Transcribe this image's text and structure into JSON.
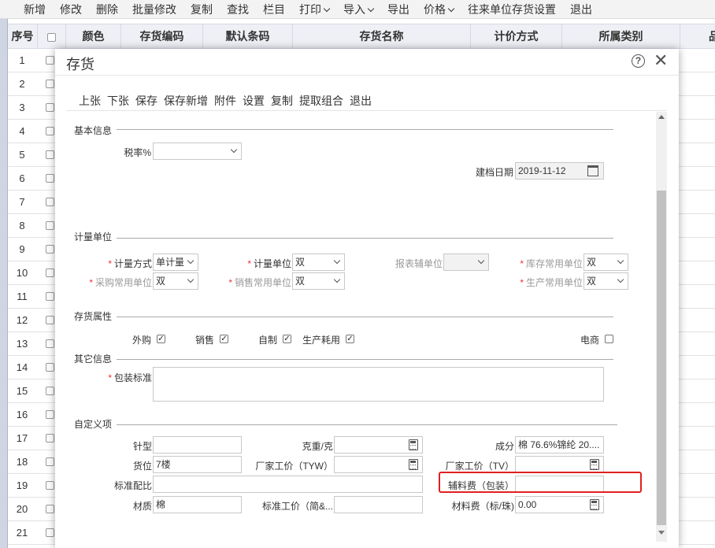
{
  "toolbar": {
    "items": [
      "新增",
      "修改",
      "删除",
      "批量修改",
      "复制",
      "查找",
      "栏目",
      "打印",
      "导入",
      "导出",
      "价格",
      "往来单位存货设置",
      "退出"
    ]
  },
  "grid": {
    "headers": [
      "序号",
      "颜色",
      "存货编码",
      "默认条码",
      "存货名称",
      "计价方式",
      "所属类别",
      "品"
    ],
    "rows": [
      "1",
      "2",
      "3",
      "4",
      "5",
      "6",
      "7",
      "8",
      "9",
      "10",
      "11",
      "12",
      "13",
      "14",
      "15",
      "16",
      "17",
      "18",
      "19",
      "20",
      "21"
    ]
  },
  "dialog": {
    "title": "存货",
    "toolbar": [
      "上张",
      "下张",
      "保存",
      "保存新增",
      "附件",
      "设置",
      "复制",
      "提取组合",
      "退出"
    ],
    "basic": {
      "section": "基本信息",
      "tax_label": "税率%",
      "tax_value": "",
      "date_label": "建档日期",
      "date_value": "2019-11-12"
    },
    "units": {
      "section": "计量单位",
      "method_label": "计量方式",
      "method_value": "单计量",
      "unit_label": "计量单位",
      "unit_value": "双",
      "report_label": "报表辅单位",
      "report_value": "",
      "stock_label": "库存常用单位",
      "stock_value": "双",
      "purchase_label": "采购常用单位",
      "purchase_value": "双",
      "sales_label": "销售常用单位",
      "sales_value": "双",
      "production_label": "生产常用单位",
      "production_value": "双"
    },
    "attrs": {
      "section": "存货属性",
      "outsourced": "外购",
      "sales": "销售",
      "self_made": "自制",
      "consumed": "生产耗用",
      "ecommerce": "电商",
      "check_mark": "✓"
    },
    "other": {
      "section": "其它信息",
      "packaging_label": "包装标准",
      "packaging_value": ""
    },
    "custom": {
      "section": "自定义项",
      "needle_label": "针型",
      "needle_value": "",
      "weight_label": "克重/克",
      "weight_value": "",
      "composition_label": "成分",
      "composition_value": "棉 76.6%锦纶 20....",
      "location_label": "货位",
      "location_value": "7楼",
      "factory_tyw_label": "厂家工价（TYW）",
      "factory_tyw_value": "",
      "factory_tv_label": "厂家工价（TV）",
      "factory_tv_value": "",
      "ratio_label": "标准配比",
      "ratio_value": "",
      "accessory_label": "辅料费（包装）",
      "accessory_value": "",
      "material_label": "材质",
      "material_value": "棉",
      "std_price_label": "标准工价（简&...",
      "std_price_value": "",
      "material_fee_label": "材料费（标/珠)",
      "material_fee_value": "0.00"
    },
    "required_mark": "*",
    "help_glyph": "?",
    "close_glyph": "✕"
  }
}
